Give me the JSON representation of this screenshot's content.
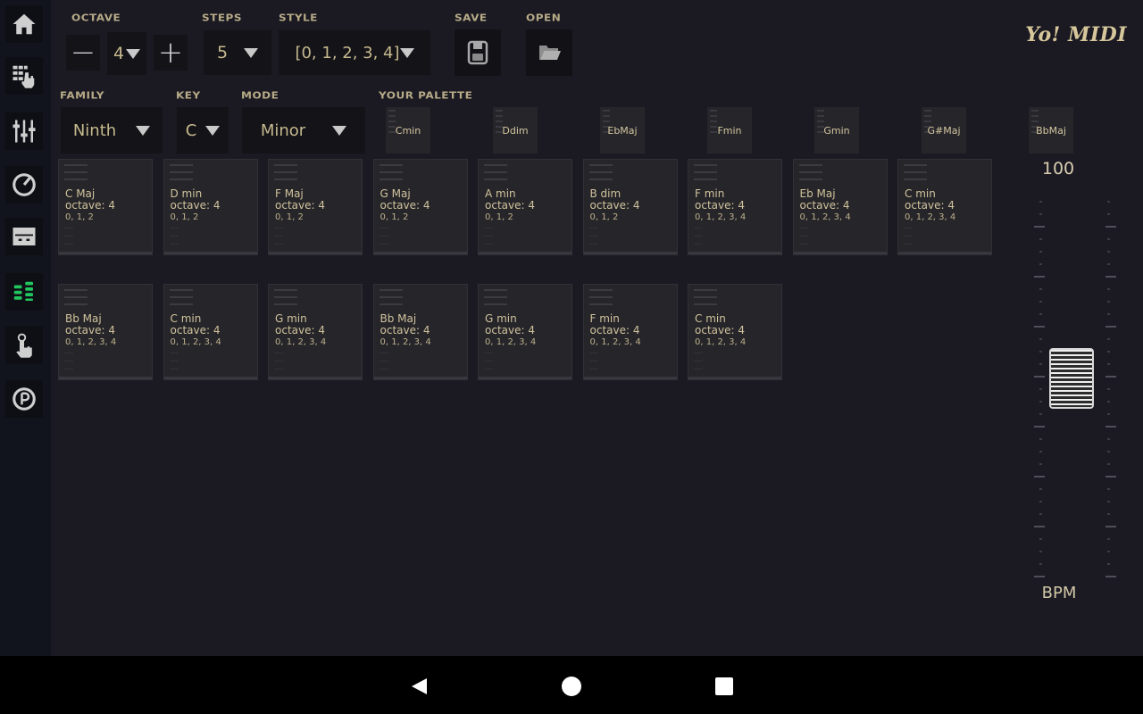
{
  "app": {
    "title": "Yo! MIDI"
  },
  "colors": {
    "accent_text": "#d6c79b",
    "active_icon": "#22c55e",
    "background": "#1b1a23",
    "sidebar": "#11141c",
    "card": "#26252a"
  },
  "sidebar": {
    "items": [
      {
        "name": "home",
        "icon": "home-icon",
        "active": false
      },
      {
        "name": "pad-grid",
        "icon": "grid-hand-icon",
        "active": false
      },
      {
        "name": "mixer",
        "icon": "sliders-icon",
        "active": false
      },
      {
        "name": "tempo",
        "icon": "gauge-icon",
        "active": false
      },
      {
        "name": "device",
        "icon": "device-icon",
        "active": false
      },
      {
        "name": "chord-sequencer",
        "icon": "chord-stack-icon",
        "active": true
      },
      {
        "name": "touch",
        "icon": "touch-hand-icon",
        "active": false
      },
      {
        "name": "play",
        "icon": "play-circle-icon",
        "active": false
      }
    ]
  },
  "toolbar": {
    "octave": {
      "label": "OCTAVE",
      "value": "4",
      "minus": "−",
      "plus": "+"
    },
    "steps": {
      "label": "STEPS",
      "value": "5"
    },
    "style": {
      "label": "STYLE",
      "value": "[0, 1, 2, 3, 4]"
    },
    "save": {
      "label": "SAVE"
    },
    "open": {
      "label": "OPEN"
    },
    "family": {
      "label": "FAMILY",
      "value": "Ninth"
    },
    "key": {
      "label": "KEY",
      "value": "C"
    },
    "mode": {
      "label": "MODE",
      "value": "Minor"
    },
    "palette_label": "YOUR PALETTE"
  },
  "palette": [
    "Cmin",
    "Ddim",
    "EbMaj",
    "Fmin",
    "Gmin",
    "G#Maj",
    "BbMaj"
  ],
  "sequence": {
    "rows": [
      [
        {
          "chord": "C Maj",
          "octave": "octave: 4",
          "notes": "0, 1, 2"
        },
        {
          "chord": "D min",
          "octave": "octave: 4",
          "notes": "0, 1, 2"
        },
        {
          "chord": "F Maj",
          "octave": "octave: 4",
          "notes": "0, 1, 2"
        },
        {
          "chord": "G Maj",
          "octave": "octave: 4",
          "notes": "0, 1, 2"
        },
        {
          "chord": "A min",
          "octave": "octave: 4",
          "notes": "0, 1, 2"
        },
        {
          "chord": "B dim",
          "octave": "octave: 4",
          "notes": "0, 1, 2"
        },
        {
          "chord": "F min",
          "octave": "octave: 4",
          "notes": "0, 1, 2, 3, 4"
        },
        {
          "chord": "Eb Maj",
          "octave": "octave: 4",
          "notes": "0, 1, 2, 3, 4"
        },
        {
          "chord": "C min",
          "octave": "octave: 4",
          "notes": "0, 1, 2, 3, 4"
        }
      ],
      [
        {
          "chord": "Bb Maj",
          "octave": "octave: 4",
          "notes": "0, 1, 2, 3, 4"
        },
        {
          "chord": "C min",
          "octave": "octave: 4",
          "notes": "0, 1, 2, 3, 4"
        },
        {
          "chord": "G min",
          "octave": "octave: 4",
          "notes": "0, 1, 2, 3, 4"
        },
        {
          "chord": "Bb Maj",
          "octave": "octave: 4",
          "notes": "0, 1, 2, 3, 4"
        },
        {
          "chord": "G min",
          "octave": "octave: 4",
          "notes": "0, 1, 2, 3, 4"
        },
        {
          "chord": "F min",
          "octave": "octave: 4",
          "notes": "0, 1, 2, 3, 4"
        },
        {
          "chord": "C min",
          "octave": "octave: 4",
          "notes": "0, 1, 2, 3, 4"
        }
      ]
    ]
  },
  "tempo": {
    "value": "100",
    "label": "BPM",
    "fader_level": 0.53
  },
  "navbar": {
    "back": "back-icon",
    "home": "home-circle-icon",
    "recents": "recents-square-icon"
  }
}
